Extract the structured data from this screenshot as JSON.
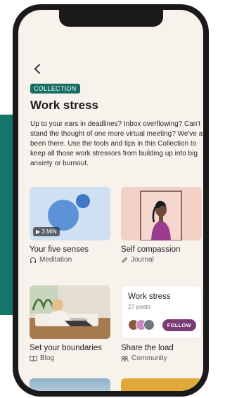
{
  "collection": {
    "badge": "COLLECTION",
    "title": "Work stress",
    "description": "Up to your ears in deadlines? Inbox overflowing? Can't stand the thought of one more virtual meeting? We've all been there. Use the tools and tips in this Collection to keep all those work stressors from building up into big anxiety or burnout."
  },
  "cards": [
    {
      "title": "Your five senses",
      "type": "Meditation",
      "type_icon": "headphones-icon",
      "duration": "3 MIN"
    },
    {
      "title": "Self compassion",
      "type": "Journal",
      "type_icon": "pencil-icon"
    },
    {
      "title": "Set your boundaries",
      "type": "Blog",
      "type_icon": "book-icon"
    },
    {
      "title": "Share the load",
      "type": "Community",
      "type_icon": "people-icon",
      "community": {
        "name": "Work stress",
        "posts": "27 posts",
        "follow_label": "FOLLOW"
      }
    }
  ],
  "colors": {
    "accent": "#176e63",
    "follow": "#7a3a74",
    "background": "#f7f3ec"
  }
}
